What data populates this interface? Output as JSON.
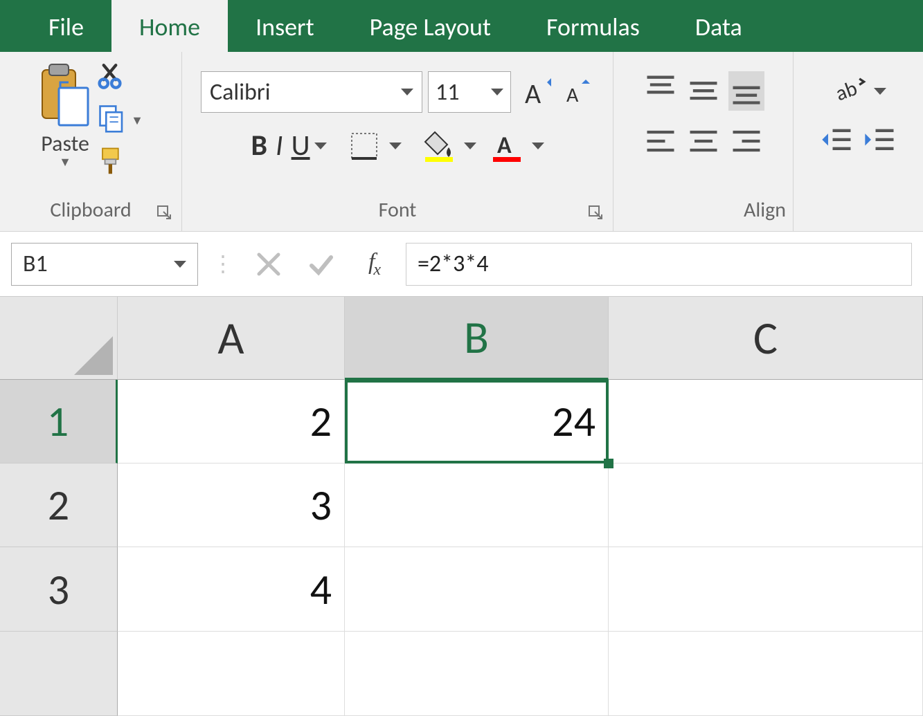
{
  "tabs": {
    "file": "File",
    "home": "Home",
    "insert": "Insert",
    "pagelayout": "Page Layout",
    "formulas": "Formulas",
    "data": "Data"
  },
  "clipboard": {
    "paste": "Paste",
    "label": "Clipboard"
  },
  "font": {
    "name": "Calibri",
    "size": "11",
    "bold": "B",
    "italic": "I",
    "underline": "U",
    "label": "Font"
  },
  "align": {
    "label": "Align"
  },
  "namebox": "B1",
  "formula": "=2*3*4",
  "cols": {
    "A": "A",
    "B": "B",
    "C": "C"
  },
  "rows": {
    "r1": "1",
    "r2": "2",
    "r3": "3"
  },
  "cells": {
    "A1": "2",
    "B1": "24",
    "A2": "3",
    "A3": "4"
  }
}
